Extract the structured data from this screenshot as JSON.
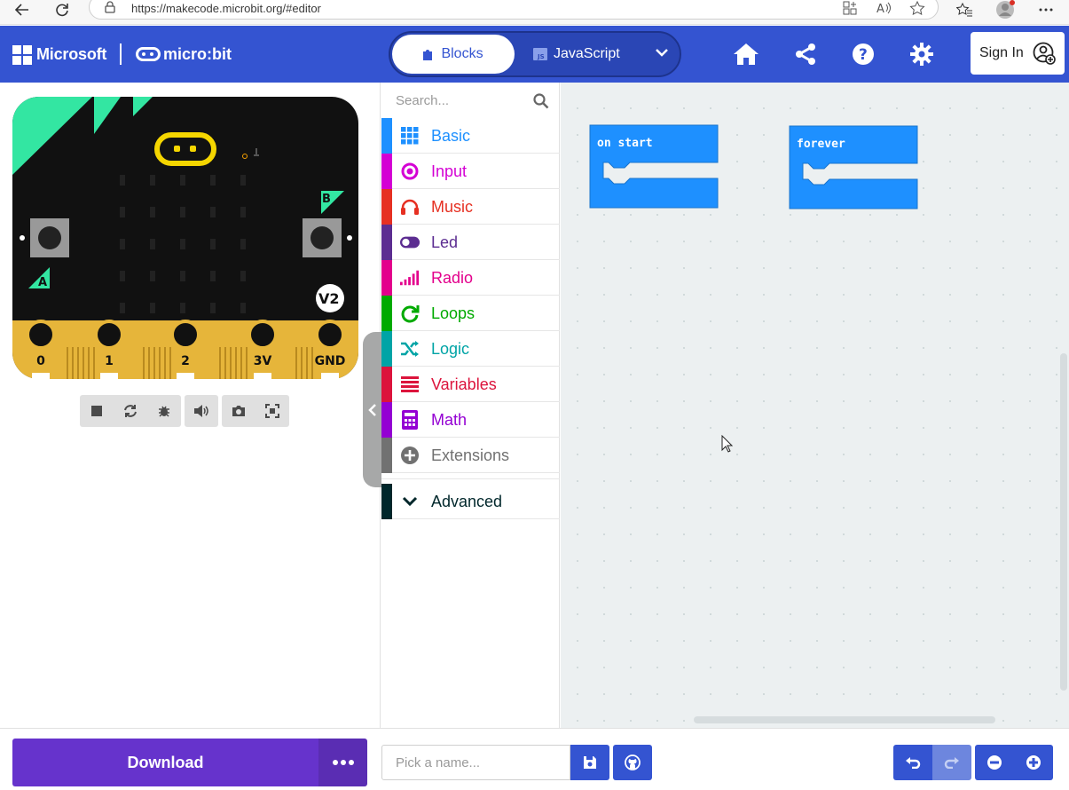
{
  "browser": {
    "url": "https://makecode.microbit.org/#editor"
  },
  "header": {
    "brand": "Microsoft",
    "product": "micro:bit",
    "tabs": {
      "blocks": "Blocks",
      "javascript": "JavaScript"
    },
    "sign_in": "Sign In",
    "accent": "#3454d1"
  },
  "simulator": {
    "pins": [
      "0",
      "1",
      "2",
      "3V",
      "GND"
    ],
    "button_a": "A",
    "button_b": "B",
    "version": "V2"
  },
  "toolbox": {
    "search_placeholder": "Search...",
    "categories": [
      {
        "label": "Basic",
        "color": "#1e90ff",
        "icon": "grid-icon"
      },
      {
        "label": "Input",
        "color": "#d400d4",
        "icon": "target-icon"
      },
      {
        "label": "Music",
        "color": "#e63022",
        "icon": "headphones-icon"
      },
      {
        "label": "Led",
        "color": "#5c2d91",
        "icon": "toggle-icon"
      },
      {
        "label": "Radio",
        "color": "#e3008c",
        "icon": "signal-bars-icon"
      },
      {
        "label": "Loops",
        "color": "#00aa00",
        "icon": "refresh-icon"
      },
      {
        "label": "Logic",
        "color": "#00a4a6",
        "icon": "shuffle-icon"
      },
      {
        "label": "Variables",
        "color": "#dc143c",
        "icon": "list-icon"
      },
      {
        "label": "Math",
        "color": "#9400d3",
        "icon": "calculator-icon"
      },
      {
        "label": "Extensions",
        "color": "#717171",
        "icon": "plus-circle-icon"
      }
    ],
    "advanced": {
      "label": "Advanced",
      "color": "#00272b"
    }
  },
  "workspace": {
    "blocks": [
      {
        "label": "on start",
        "color": "#1e90ff"
      },
      {
        "label": "forever",
        "color": "#1e90ff"
      }
    ]
  },
  "bottom": {
    "download": "Download",
    "project_placeholder": "Pick a name..."
  }
}
